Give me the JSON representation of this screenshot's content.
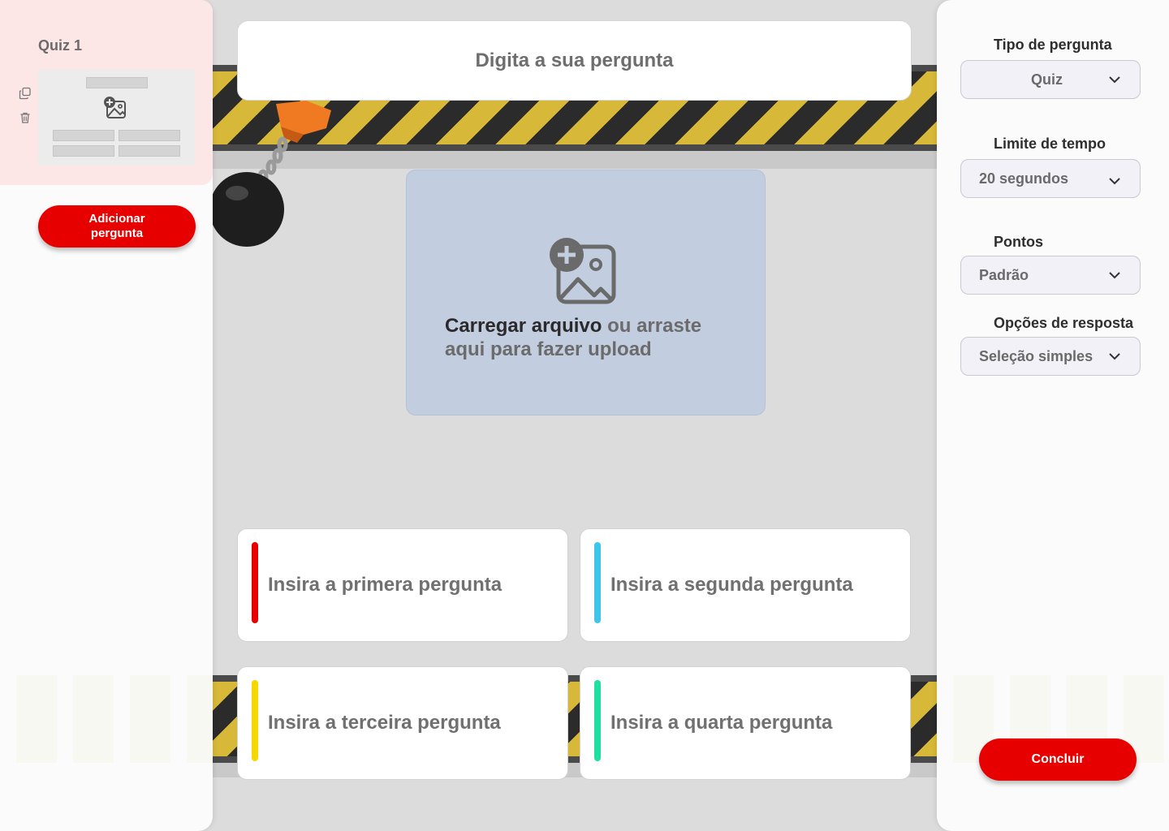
{
  "sidebar": {
    "slides": [
      {
        "title": "Quiz 1"
      }
    ],
    "add_question_label": "Adicionar pergunta"
  },
  "editor": {
    "question_placeholder": "Digita a sua pergunta",
    "upload": {
      "strong_text": "Carregar arquivo",
      "rest_text": " ou arraste aqui para fazer upload",
      "icon": "add-image-icon"
    },
    "answers": [
      {
        "placeholder": "Insira a primera pergunta",
        "color": "#e60000"
      },
      {
        "placeholder": "Insira a segunda pergunta",
        "color": "#3ec6ea"
      },
      {
        "placeholder": "Insira a terceira pergunta",
        "color": "#f5d800"
      },
      {
        "placeholder": "Insira a quarta pergunta",
        "color": "#1fe0a0"
      }
    ]
  },
  "settings": {
    "question_type": {
      "label": "Tipo de pergunta",
      "value": "Quiz"
    },
    "time_limit": {
      "label": "Limite de tempo",
      "value": "20 segundos"
    },
    "points": {
      "label": "Pontos",
      "value": "Padrão"
    },
    "answer_options": {
      "label": "Opções de resposta",
      "value": "Seleção simples"
    },
    "conclude_label": "Concluir"
  },
  "colors": {
    "accent": "#e60000",
    "hazard_yellow": "#d8b838",
    "hazard_black": "#2b2b2b",
    "upload_bg": "#c3cde0"
  }
}
